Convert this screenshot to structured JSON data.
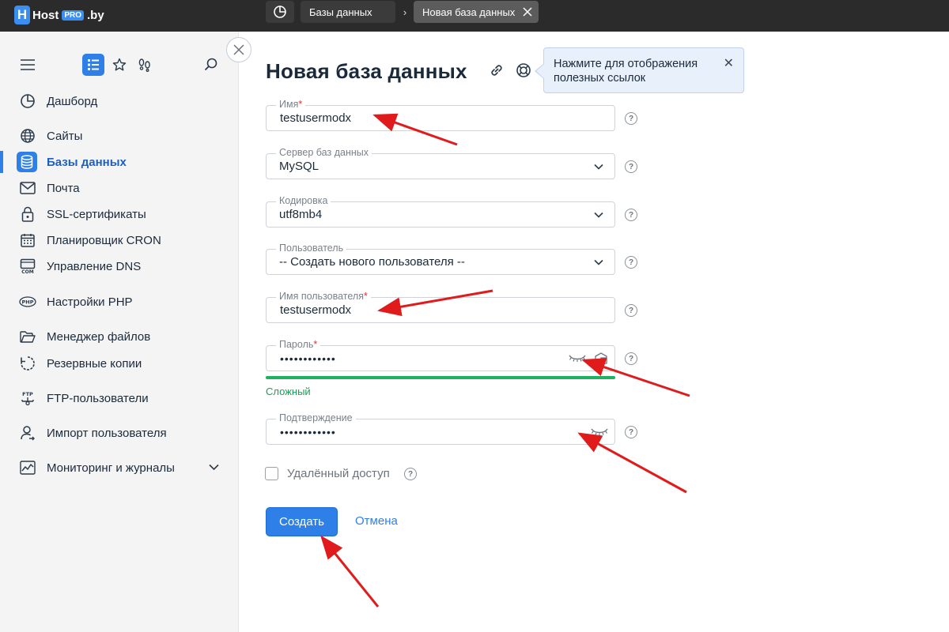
{
  "topbar": {
    "logo_pre": "Host",
    "logo_pro": "PRO",
    "logo_suffix": ".by",
    "breadcrumb_db": "Базы данных",
    "breadcrumb_separator": "›",
    "active_tab": "Новая база данных"
  },
  "sidebar": {
    "items": [
      {
        "label": "Дашборд",
        "icon": "dashboard-icon"
      },
      {
        "label": "Сайты",
        "icon": "globe-icon"
      },
      {
        "label": "Базы данных",
        "icon": "database-icon",
        "active": true
      },
      {
        "label": "Почта",
        "icon": "mail-icon"
      },
      {
        "label": "SSL-сертификаты",
        "icon": "lock-icon"
      },
      {
        "label": "Планировщик CRON",
        "icon": "calendar-icon"
      },
      {
        "label": "Управление DNS",
        "icon": "dns-icon"
      },
      {
        "label": "Настройки PHP",
        "icon": "php-icon"
      },
      {
        "label": "Менеджер файлов",
        "icon": "folder-icon"
      },
      {
        "label": "Резервные копии",
        "icon": "backup-icon"
      },
      {
        "label": "FTP-пользователи",
        "icon": "ftp-icon"
      },
      {
        "label": "Импорт пользователя",
        "icon": "user-import-icon"
      },
      {
        "label": "Мониторинг и журналы",
        "icon": "monitoring-icon"
      }
    ]
  },
  "page": {
    "title": "Новая база данных",
    "tip": "Нажмите для отображения полезных ссылок",
    "tip_close": "✕"
  },
  "form": {
    "name_label": "Имя",
    "name_value": "testusermodx",
    "server_label": "Сервер баз данных",
    "server_value": "MySQL",
    "encoding_label": "Кодировка",
    "encoding_value": "utf8mb4",
    "user_label": "Пользователь",
    "user_value": "-- Создать нового пользователя --",
    "username_label": "Имя пользователя",
    "username_value": "testusermodx",
    "password_label": "Пароль",
    "password_value": "••••••••••••",
    "strength_label": "Сложный",
    "confirm_label": "Подтверждение",
    "confirm_value": "••••••••••••",
    "required_mark": "*",
    "help_mark": "?",
    "remote_access_label": "Удалённый доступ",
    "create_button": "Создать",
    "cancel_link": "Отмена"
  },
  "colors": {
    "accent": "#2f7fe8",
    "strength": "#1db25f",
    "annotation_arrow": "#e01b1b"
  }
}
